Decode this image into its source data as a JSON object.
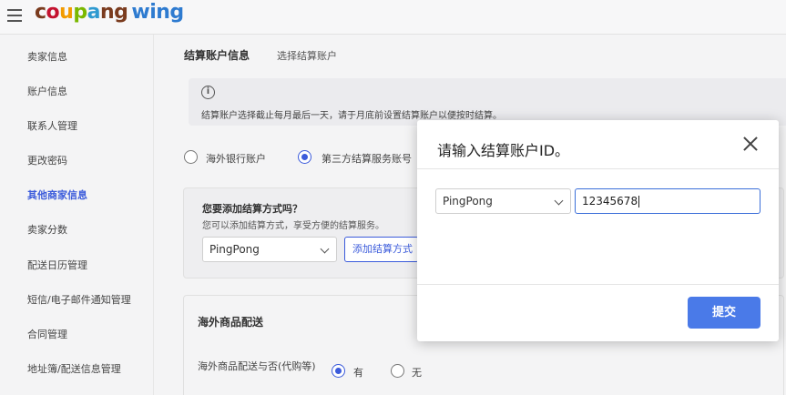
{
  "header": {
    "logo_parts": [
      "c",
      "o",
      "u",
      "p",
      "a",
      "ng"
    ],
    "logo_wing": "wing"
  },
  "sidebar": {
    "items": [
      {
        "label": "卖家信息"
      },
      {
        "label": "账户信息"
      },
      {
        "label": "联系人管理"
      },
      {
        "label": "更改密码"
      },
      {
        "label": "其他商家信息",
        "active": true
      },
      {
        "label": "卖家分数"
      },
      {
        "label": "配送日历管理"
      },
      {
        "label": "短信/电子邮件通知管理"
      },
      {
        "label": "合同管理"
      },
      {
        "label": "地址簿/配送信息管理"
      }
    ]
  },
  "main": {
    "section_title": "结算账户信息",
    "section_sub": "选择结算账户",
    "notice_text": "结算账户选择截止每月最后一天，请于月底前设置结算账户以便按时结算。",
    "account_options": {
      "overseas_bank": "海外银行账户",
      "third_party": "第三方结算服务账号"
    },
    "add_method": {
      "question": "您要添加结算方式吗？",
      "description": "您可以添加结算方式，享受方便的结算服务。",
      "select_value": "PingPong",
      "add_button": "添加结算方式"
    },
    "shipping": {
      "title": "海外商品配送",
      "question": "海外商品配送与否(代购等)",
      "yes": "有",
      "no": "无"
    }
  },
  "modal": {
    "title": "请输入结算账户ID。",
    "select_value": "PingPong",
    "input_value": "12345678",
    "submit": "提交"
  },
  "colors": {
    "accent": "#3b5bdb",
    "submit": "#4a7ae8"
  }
}
